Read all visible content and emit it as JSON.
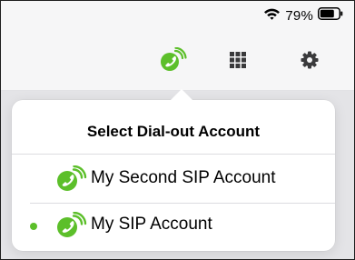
{
  "status_bar": {
    "battery_percent": "79%",
    "wifi_icon": "wifi-icon",
    "battery_icon": "battery-icon"
  },
  "toolbar": {
    "buttons": [
      {
        "name": "dial-out-account-button",
        "icon": "sip-phone-icon",
        "color": "#5cbf2a"
      },
      {
        "name": "keypad-button",
        "icon": "grid-icon",
        "color": "#3a3a3c"
      },
      {
        "name": "settings-button",
        "icon": "gear-icon",
        "color": "#3a3a3c"
      }
    ]
  },
  "popover": {
    "title": "Select Dial-out Account",
    "accounts": [
      {
        "label": "My Second SIP Account",
        "selected": false,
        "icon": "sip-account-icon"
      },
      {
        "label": "My SIP Account",
        "selected": true,
        "icon": "sip-account-icon"
      }
    ]
  },
  "colors": {
    "accent_green": "#5cbf2a",
    "icon_gray": "#3a3a3c"
  }
}
